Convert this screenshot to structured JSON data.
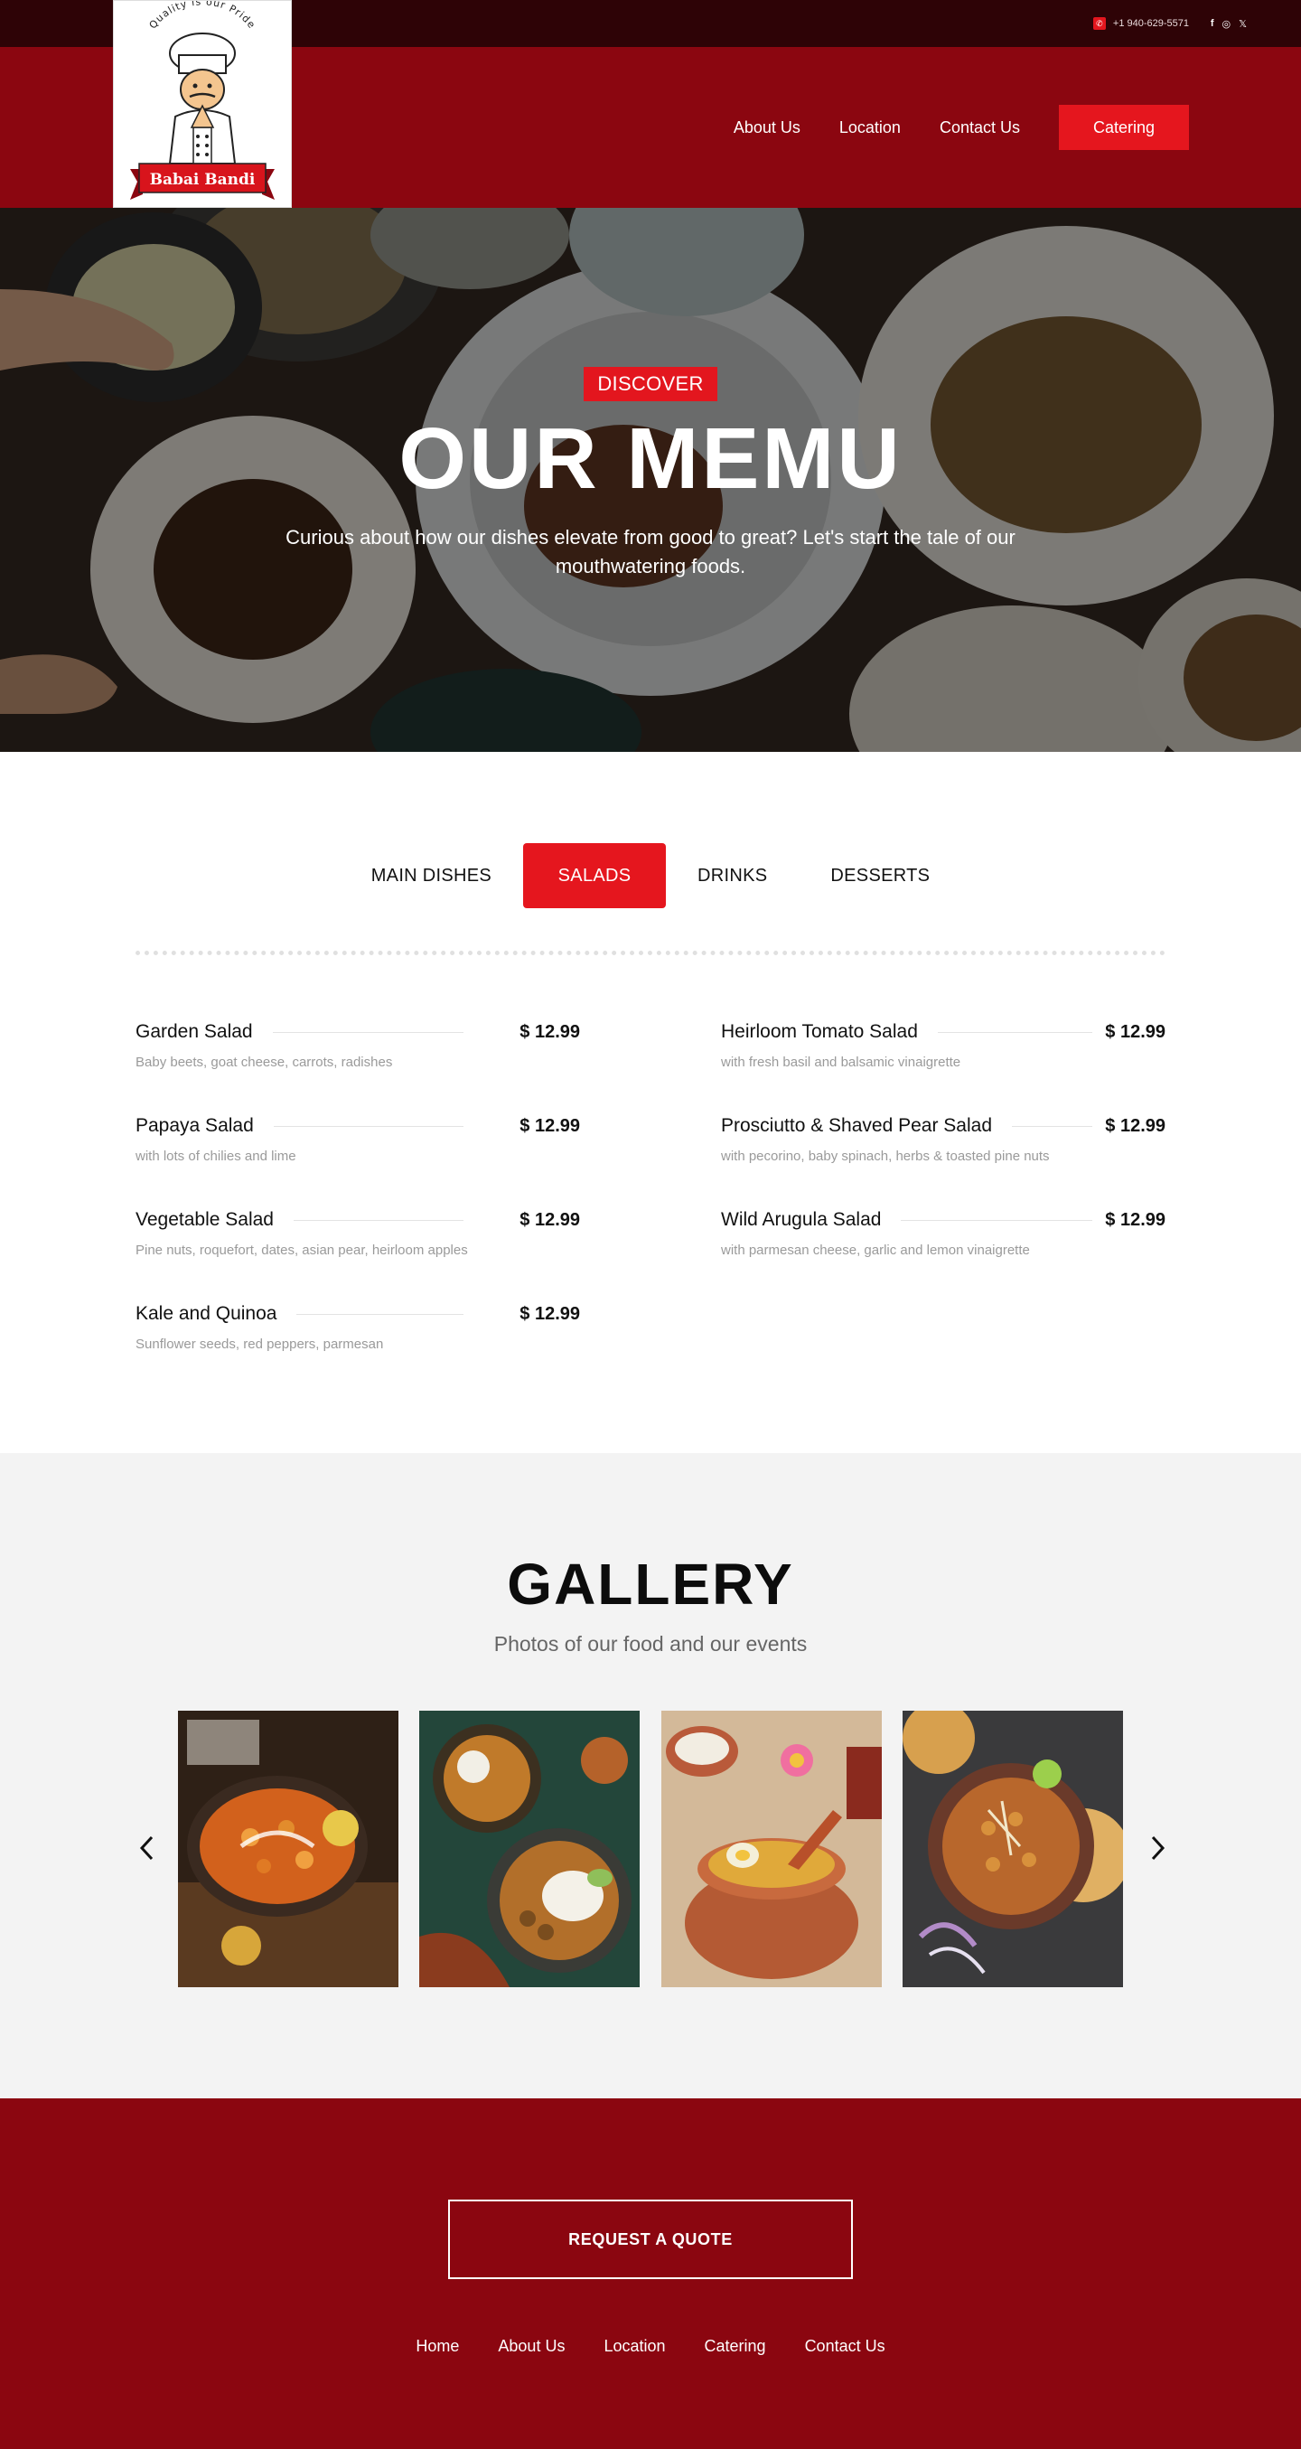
{
  "topbar": {
    "phone": "+1 940-629-5571",
    "phone_icon": "phone-icon",
    "social": [
      {
        "icon": "facebook-icon",
        "glyph": "f"
      },
      {
        "icon": "instagram-icon",
        "glyph": "◎"
      },
      {
        "icon": "x-icon",
        "glyph": "𝕏"
      }
    ]
  },
  "logo": {
    "tagline": "Quality is our Pride",
    "brand": "Babai Bandi"
  },
  "nav": {
    "items": [
      "About Us",
      "Location",
      "Contact Us"
    ],
    "catering": "Catering"
  },
  "hero": {
    "badge": "DISCOVER",
    "title": "OUR MEMU",
    "subtitle": "Curious about how our dishes elevate from good to great? Let's start the tale of our mouthwatering foods."
  },
  "menu": {
    "tabs": [
      "MAIN DISHES",
      "SALADS",
      "DRINKS",
      "DESSERTS"
    ],
    "active_tab": "SALADS",
    "left": [
      {
        "name": "Garden Salad",
        "price": "$ 12.99",
        "desc": "Baby beets, goat cheese, carrots, radishes"
      },
      {
        "name": "Papaya Salad",
        "price": "$ 12.99",
        "desc": "with lots of chilies and lime"
      },
      {
        "name": "Vegetable Salad",
        "price": "$ 12.99",
        "desc": "Pine nuts, roquefort, dates, asian pear, heirloom apples"
      },
      {
        "name": "Kale and Quinoa",
        "price": "$ 12.99",
        "desc": "Sunflower seeds, red peppers, parmesan"
      }
    ],
    "right": [
      {
        "name": "Heirloom Tomato Salad",
        "price": "$ 12.99",
        "desc": "with fresh basil and balsamic vinaigrette"
      },
      {
        "name": "Prosciutto & Shaved Pear Salad",
        "price": "$ 12.99",
        "desc": "with pecorino, baby spinach, herbs & toasted pine nuts"
      },
      {
        "name": "Wild Arugula Salad",
        "price": "$ 12.99",
        "desc": "with parmesan cheese, garlic and lemon vinaigrette"
      }
    ]
  },
  "gallery": {
    "title": "GALLERY",
    "subtitle": "Photos of our food and our events",
    "prev_icon": "chevron-left-icon",
    "next_icon": "chevron-right-icon"
  },
  "footer": {
    "cta": "REQUEST A QUOTE",
    "links": [
      "Home",
      "About Us",
      "Location",
      "Catering",
      "Contact Us"
    ]
  },
  "colors": {
    "brand_red": "#e5161e",
    "dark_red": "#8b0610",
    "topbar": "#2e0306"
  }
}
